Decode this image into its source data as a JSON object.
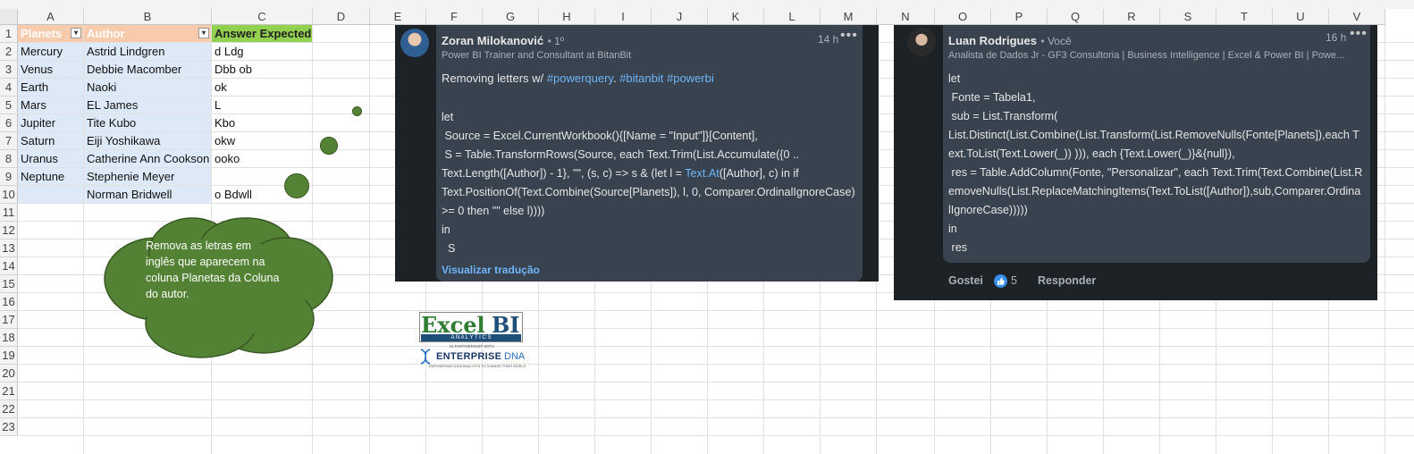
{
  "columns": [
    "A",
    "B",
    "C",
    "D",
    "E",
    "F",
    "G",
    "H",
    "I",
    "J",
    "K",
    "L",
    "M",
    "N",
    "O",
    "P",
    "Q",
    "R",
    "S",
    "T",
    "U",
    "V"
  ],
  "rows": [
    "1",
    "2",
    "3",
    "4",
    "5",
    "6",
    "7",
    "8",
    "9",
    "10",
    "11",
    "12",
    "13",
    "14",
    "15",
    "16",
    "17",
    "18",
    "19",
    "20",
    "21",
    "22",
    "23"
  ],
  "table": {
    "headers": {
      "planets": "Planets",
      "author": "Author",
      "answer": "Answer Expected"
    },
    "rows": [
      {
        "planet": "Mercury",
        "author": "Astrid Lindgren",
        "answer": "d Ldg"
      },
      {
        "planet": "Venus",
        "author": "Debbie Macomber",
        "answer": "Dbb ob"
      },
      {
        "planet": "Earth",
        "author": "Naoki",
        "answer": "ok"
      },
      {
        "planet": "Mars",
        "author": "EL James",
        "answer": "L"
      },
      {
        "planet": "Jupiter",
        "author": "Tite Kubo",
        "answer": "Kbo"
      },
      {
        "planet": "Saturn",
        "author": "Eiji Yoshikawa",
        "answer": "okw"
      },
      {
        "planet": "Uranus",
        "author": "Catherine Ann Cookson",
        "answer": "ooko"
      },
      {
        "planet": "Neptune",
        "author": "Stephenie Meyer",
        "answer": ""
      },
      {
        "planet": "",
        "author": "Norman Bridwell",
        "answer": "o Bdwll"
      }
    ]
  },
  "cloud": {
    "text": "Remova as letras em inglês que aparecem na coluna Planetas da Coluna do autor."
  },
  "comment1": {
    "name": "Zoran Milokanović",
    "degree": "• 1º",
    "time": "14 h",
    "headline": "Power BI Trainer and Consultant at BitanBit",
    "intro": "Removing letters w/ ",
    "tag1": "#powerquery",
    "dot": ". ",
    "tag2": "#bitanbit",
    "space": " ",
    "tag3": "#powerbi",
    "code_a": "let\n Source = Excel.CurrentWorkbook(){[Name = \"Input\"]}[Content],\n S = Table.TransformRows(Source, each Text.Trim(List.Accumulate({0 .. Text.Length([Author]) - 1}, \"\", (s, c) => s & (let l = ",
    "code_link": "Text.At",
    "code_b": "([Author], c) in if Text.PositionOf(Text.Combine(Source[Planets]), l, 0, Comparer.OrdinalIgnoreCase) >= 0 then \"\" else l))))\nin\n  S",
    "translate": "Visualizar tradução"
  },
  "comment2": {
    "name": "Luan Rodrigues",
    "you": "• Você",
    "time": "16 h",
    "headline": "Analista de Dados Jr - GF3 Consultoria | Business Intelligence | Excel & Power BI | Powe...",
    "code": "let\n Fonte = Tabela1,\n sub = List.Transform(\nList.Distinct(List.Combine(List.Transform(List.RemoveNulls(Fonte[Planets]),each Text.ToList(Text.Lower(_)) ))), each {Text.Lower(_)}&{null}),\n res = Table.AddColumn(Fonte, \"Personalizar\", each Text.Trim(Text.Combine(List.RemoveNulls(List.ReplaceMatchingItems(Text.ToList([Author]),sub,Comparer.OrdinalIgnoreCase)))))\nin\n res",
    "like": "Gostei",
    "like_count": "5",
    "reply": "Responder"
  },
  "logo": {
    "excel": "Excel",
    "bi": "BI",
    "analytics": "A N A L Y T I C S",
    "partnership": "IN PARTNERSHIP WITH",
    "enterprise": "ENTERPRISE",
    "dna": "DNA",
    "tagline": "EMPOWERING DATA ANALYSTS TO CHANGE THEIR WORLD"
  },
  "icons": {
    "more": "more-horizontal-icon",
    "like": "thumbs-up-icon",
    "filter": "filter-dropdown-icon",
    "dna": "dna-helix-icon"
  },
  "colors": {
    "header_fill": "#f8cbad",
    "answer_header": "#92d050",
    "table_band": "#dde9f6",
    "cloud": "#548235",
    "card_bg": "#1d2226",
    "bubble_bg": "#38434f",
    "link": "#70b5f9"
  }
}
